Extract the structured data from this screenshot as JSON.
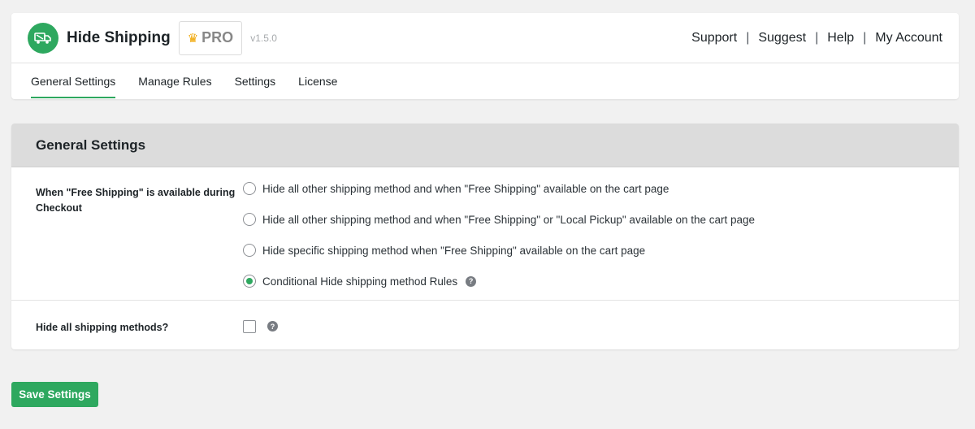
{
  "header": {
    "logo_icon": "truck-icon",
    "title": "Hide Shipping",
    "pro_badge": "PRO",
    "version": "v1.5.0",
    "links": [
      "Support",
      "Suggest",
      "Help",
      "My Account"
    ],
    "link_separator": "|"
  },
  "nav": {
    "tabs": [
      {
        "label": "General Settings",
        "active": true
      },
      {
        "label": "Manage Rules",
        "active": false
      },
      {
        "label": "Settings",
        "active": false
      },
      {
        "label": "License",
        "active": false
      }
    ]
  },
  "settings": {
    "title": "General Settings",
    "free_shipping": {
      "label": "When \"Free Shipping\" is available during Checkout",
      "options": [
        {
          "label": "Hide all other shipping method and when \"Free Shipping\" available on the cart page",
          "checked": false
        },
        {
          "label": "Hide all other shipping method and when \"Free Shipping\" or \"Local Pickup\" available on the cart page",
          "checked": false
        },
        {
          "label": "Hide specific shipping method when \"Free Shipping\" available on the cart page",
          "checked": false
        },
        {
          "label": "Conditional Hide shipping method Rules",
          "checked": true
        }
      ],
      "help_glyph": "?"
    },
    "hide_all": {
      "label": "Hide all shipping methods?",
      "checked": false,
      "help_glyph": "?"
    }
  },
  "actions": {
    "save_label": "Save Settings"
  },
  "colors": {
    "accent": "#2ea85f",
    "pro_crown": "#f0a500"
  }
}
